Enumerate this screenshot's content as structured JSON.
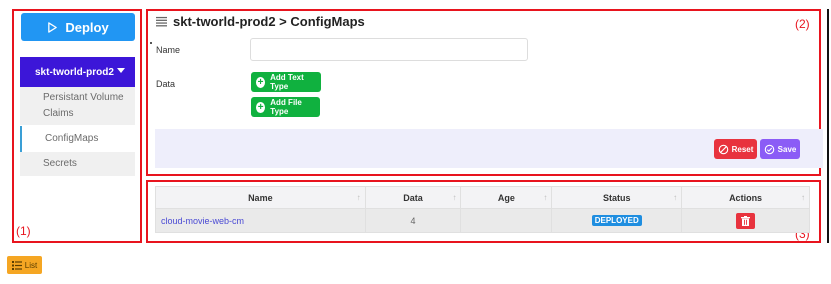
{
  "sidebar": {
    "deploy_label": "Deploy",
    "namespace": "skt-tworld-prod2",
    "items": [
      {
        "label": "Persistant Volume Claims"
      },
      {
        "label": "ConfigMaps",
        "active": true
      },
      {
        "label": "Secrets"
      }
    ]
  },
  "form": {
    "breadcrumb": "skt-tworld-prod2 > ConfigMaps",
    "name_label": "Name",
    "name_value": "",
    "data_label": "Data",
    "add_text_type": "Add Text Type",
    "add_file_type": "Add File Type",
    "reset_label": "Reset",
    "save_label": "Save"
  },
  "table": {
    "columns": [
      "Name",
      "Data",
      "Age",
      "Status",
      "Actions"
    ],
    "rows": [
      {
        "name": "cloud-movie-web-cm",
        "data": "4",
        "age": "",
        "status": "DEPLOYED"
      }
    ]
  },
  "annotations": {
    "panel1": "(1)",
    "panel2": "(2)",
    "panel3": "(3)"
  },
  "footer": {
    "list_label": "List"
  },
  "colors": {
    "primary": "#2196f3",
    "namespace_bg": "#3c16d8",
    "success": "#10b13f",
    "danger": "#e8333e",
    "save": "#8b5cf6",
    "status": "#1f8ee0",
    "list_btn": "#f5a623",
    "annotation": "#e8141e"
  },
  "icons": {
    "deploy": "play-outline-icon",
    "title": "list-lines-icon",
    "add": "plus-circle-icon",
    "reset": "ban-icon",
    "save": "check-circle-icon",
    "delete": "trash-icon",
    "list": "list-bullets-icon"
  }
}
